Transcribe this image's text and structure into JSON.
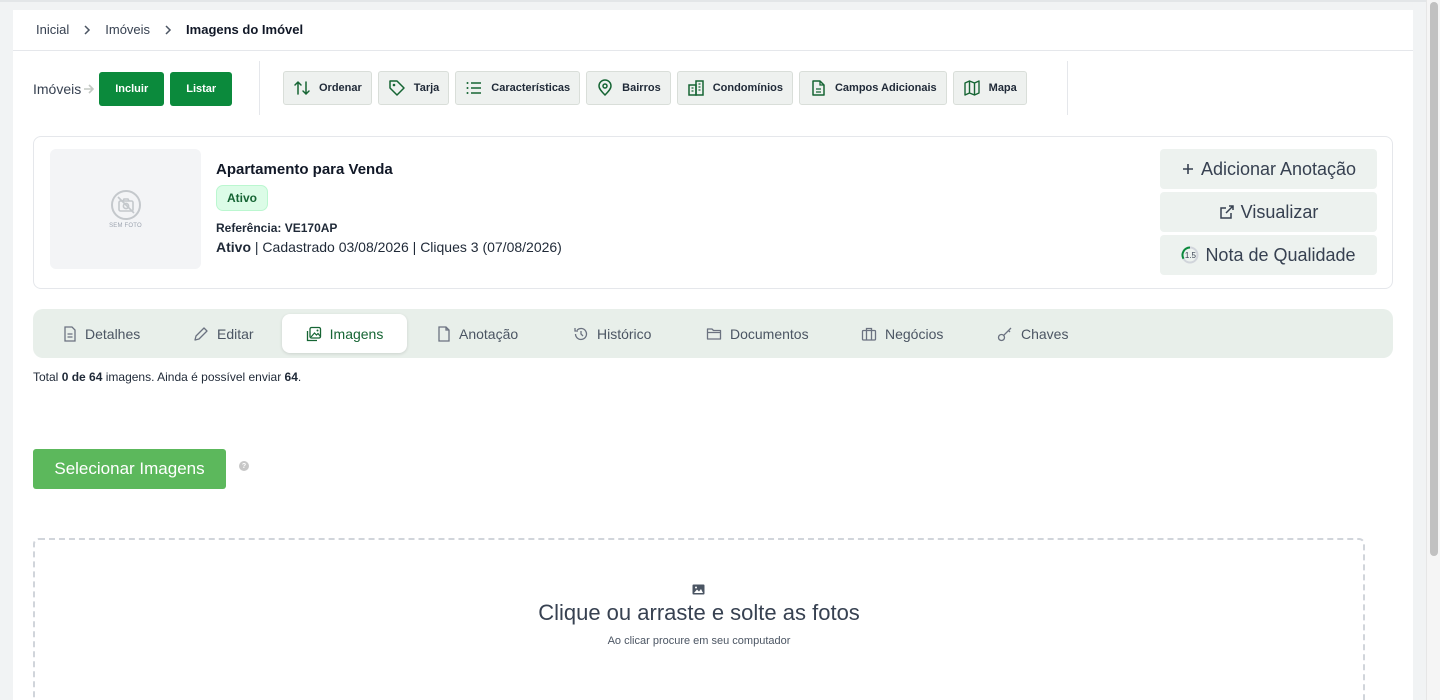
{
  "breadcrumb": {
    "home": "Inicial",
    "section": "Imóveis",
    "current": "Imagens do Imóvel"
  },
  "toolbar": {
    "label": "Imóveis",
    "include": "Incluir",
    "list": "Listar",
    "tools": [
      {
        "label": "Ordenar",
        "icon": "sort-arrows-icon"
      },
      {
        "label": "Tarja",
        "icon": "tag-icon"
      },
      {
        "label": "Características",
        "icon": "list-icon"
      },
      {
        "label": "Bairros",
        "icon": "map-pin-icon"
      },
      {
        "label": "Condomínios",
        "icon": "building-icon"
      },
      {
        "label": "Campos Adicionais",
        "icon": "document-icon"
      },
      {
        "label": "Mapa",
        "icon": "map-icon"
      }
    ]
  },
  "property": {
    "photo_caption": "SEM FOTO",
    "title": "Apartamento para Venda",
    "badge": "Ativo",
    "ref_label": "Referência:",
    "ref_value": "VE170AP",
    "status": "Ativo",
    "registered": "Cadastrado 03/08/2026",
    "clicks": "Cliques 3 (07/08/2026)",
    "sep": "|"
  },
  "actions": {
    "add_note": "Adicionar Anotação",
    "view": "Visualizar",
    "quality_label": "Nota de Qualidade",
    "quality_score": "1.5"
  },
  "tabs": [
    {
      "label": "Detalhes",
      "icon": "document-icon",
      "active": false
    },
    {
      "label": "Editar",
      "icon": "pencil-icon",
      "active": false
    },
    {
      "label": "Imagens",
      "icon": "images-icon",
      "active": true
    },
    {
      "label": "Anotação",
      "icon": "note-icon",
      "active": false
    },
    {
      "label": "Histórico",
      "icon": "history-icon",
      "active": false
    },
    {
      "label": "Documentos",
      "icon": "folder-icon",
      "active": false
    },
    {
      "label": "Negócios",
      "icon": "briefcase-icon",
      "active": false
    },
    {
      "label": "Chaves",
      "icon": "key-icon",
      "active": false
    }
  ],
  "images_info": {
    "prefix": "Total",
    "count": "0 de 64",
    "middle": "imagens. Ainda é possível enviar",
    "remaining": "64",
    "suffix": "."
  },
  "upload": {
    "select_button": "Selecionar Imagens",
    "help": "?",
    "dropzone_title": "Clique ou arraste e solte as fotos",
    "dropzone_subtitle": "Ao clicar procure em seu computador"
  },
  "colors": {
    "primary_green": "#0b8a3c",
    "select_green": "#5cb85c",
    "badge_bg": "#dcfce7",
    "tab_bar_bg": "#e8efea",
    "active_tab_text": "#166534"
  }
}
